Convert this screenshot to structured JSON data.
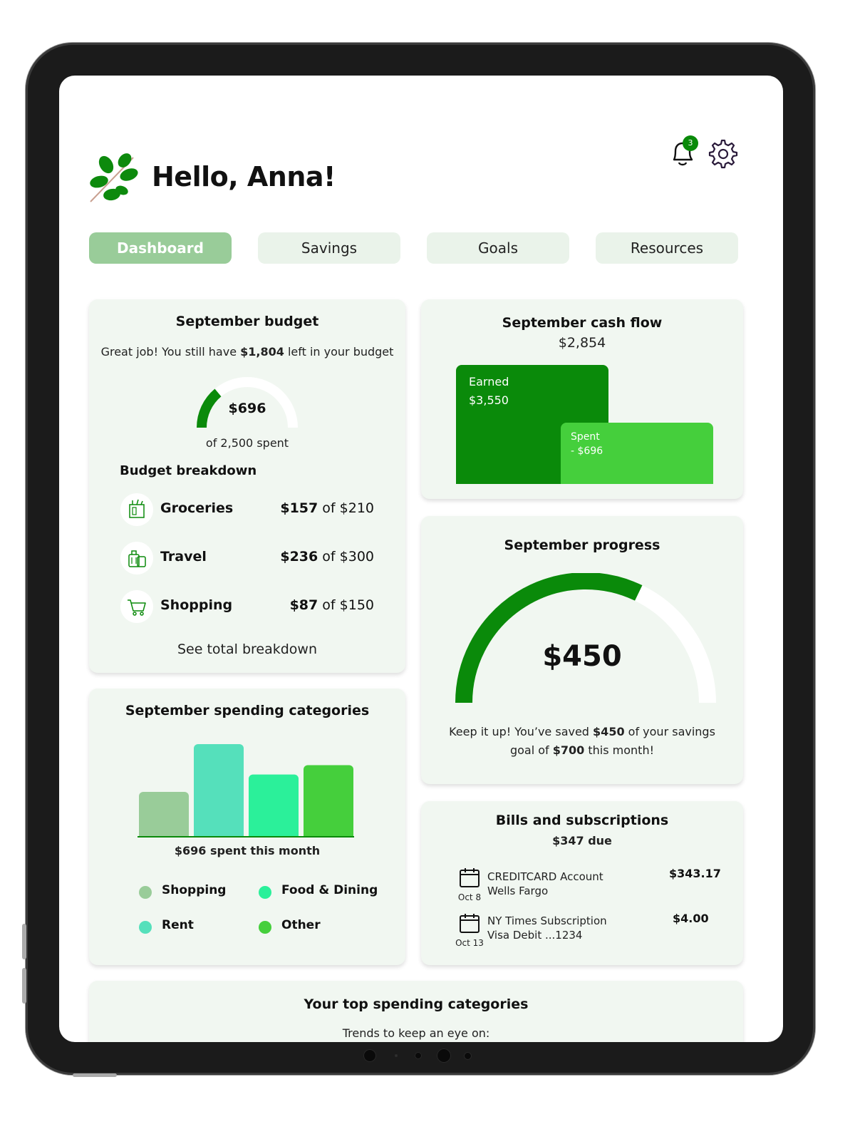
{
  "greeting": "Hello, Anna!",
  "notifications": {
    "count": "3"
  },
  "tabs": [
    {
      "label": "Dashboard",
      "active": true
    },
    {
      "label": "Savings",
      "active": false
    },
    {
      "label": "Goals",
      "active": false
    },
    {
      "label": "Resources",
      "active": false
    }
  ],
  "budget": {
    "title": "September budget",
    "message_pre": "Great job! You still have ",
    "message_amount": "$1,804",
    "message_post": " left in your budget",
    "gauge_value": "$696",
    "gauge_fraction": 0.2784,
    "gauge_caption": "of 2,500 spent",
    "breakdown_title": "Budget breakdown",
    "items": [
      {
        "label": "Groceries",
        "spent": "$157",
        "of": " of $210",
        "icon": "groceries-icon"
      },
      {
        "label": "Travel",
        "spent": "$236",
        "of": " of $300",
        "icon": "luggage-icon"
      },
      {
        "label": "Shopping",
        "spent": "$87",
        "of": " of $150",
        "icon": "cart-icon"
      }
    ],
    "link": "See total breakdown"
  },
  "cash_flow": {
    "title": "September cash flow",
    "net": "$2,854",
    "earned_label": "Earned",
    "earned_value": "$3,550",
    "spent_label": "Spent",
    "spent_value": "- $696"
  },
  "progress": {
    "title": "September progress",
    "value": "$450",
    "fraction": 0.643,
    "msg_pre": "Keep it up! You’ve saved ",
    "msg_saved": "$450",
    "msg_mid": " of your savings",
    "msg_goal_pre": "goal of ",
    "msg_goal": "$700",
    "msg_post": " this month!"
  },
  "spending": {
    "title": "September spending categories",
    "caption": "$696 spent this month",
    "legend": [
      {
        "label": "Shopping",
        "color": "#99cc99"
      },
      {
        "label": "Food & Dining",
        "color": "#2bf09a"
      },
      {
        "label": "Rent",
        "color": "#55e0bb"
      },
      {
        "label": "Other",
        "color": "#45cf3c"
      }
    ]
  },
  "chart_data": {
    "type": "bar",
    "categories": [
      "Shopping",
      "Rent",
      "Food & Dining",
      "Other"
    ],
    "values": [
      62,
      128,
      86,
      99
    ],
    "colors": [
      "#99cc99",
      "#55e0bb",
      "#2bf09a",
      "#45cf3c"
    ],
    "title": "September spending categories",
    "xlabel": "$696 spent this month",
    "ylabel": "",
    "ylim": [
      0,
      130
    ]
  },
  "bills": {
    "title": "Bills and subscriptions",
    "due": "$347 due",
    "items": [
      {
        "date": "Oct 8",
        "line1": "CREDITCARD Account",
        "line2": "Wells Fargo",
        "amount": "$343.17"
      },
      {
        "date": "Oct 13",
        "line1": "NY Times Subscription",
        "line2": "Visa Debit ...1234",
        "amount": "$4.00"
      }
    ]
  },
  "top_spending": {
    "title": "Your top spending categories",
    "subtitle": "Trends to keep an eye on:"
  },
  "colors": {
    "brand_green": "#0a8a0a",
    "light_green": "#45cf3c",
    "active_tab": "#99cc99",
    "card_bg": "#f1f7f1"
  }
}
